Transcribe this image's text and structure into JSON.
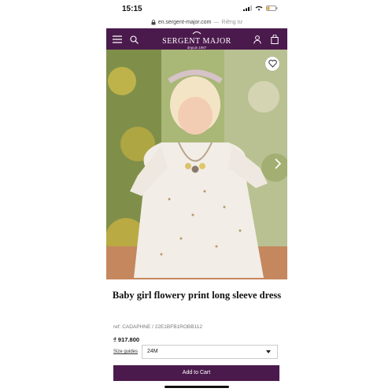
{
  "status": {
    "time": "15:15"
  },
  "urlbar": {
    "domain": "en.sergent-major.com",
    "separator": "—",
    "mode": "Riêng tư"
  },
  "nav": {
    "brand": "SERGENT MAJOR",
    "tagline": "depuis 1987"
  },
  "product": {
    "title": "Baby girl flowery print long sleeve dress",
    "ref": "ref: CADAPHNE / 22E1BFB1ROBB112",
    "price": "₫ 917.800",
    "size_guide_label": "Size guides",
    "size_selected": "24M",
    "add_to_cart_label": "Add to Cart"
  },
  "colors": {
    "brand_purple": "#4b1a4d"
  },
  "icons": [
    "lock-icon",
    "menu-icon",
    "search-icon",
    "user-icon",
    "bag-icon",
    "heart-icon",
    "chevron-right-icon",
    "chevron-down-icon"
  ]
}
